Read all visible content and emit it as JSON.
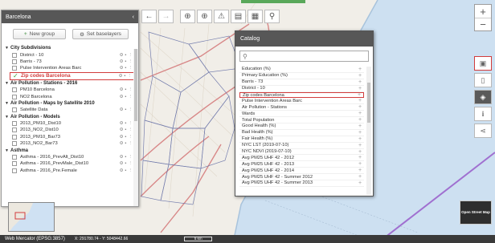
{
  "layer_panel": {
    "title": "Barcelona",
    "collapse_icon": "chevron-left-icon",
    "new_group_label": "New group",
    "set_baselayers_label": "Set baselayers",
    "groups": [
      {
        "name": "City Subdivisions",
        "layers": [
          {
            "name": "District - 10",
            "active": false
          },
          {
            "name": "Barris - 73",
            "active": false
          },
          {
            "name": "Pulse Intervention Areas Barc",
            "active": false
          },
          {
            "name": "Zip codes Barcelona",
            "active": true
          }
        ]
      },
      {
        "name": "Air Pollution - Stations - 2016",
        "layers": [
          {
            "name": "PM10 Barcelona",
            "active": false
          },
          {
            "name": "NO2 Barcelona",
            "active": false
          }
        ]
      },
      {
        "name": "Air Pollution - Maps by Satellite 2010",
        "layers": [
          {
            "name": "Satellite Data",
            "active": false
          }
        ]
      },
      {
        "name": "Air Pollution - Models",
        "layers": [
          {
            "name": "2013_PM10_Dist10",
            "active": false
          },
          {
            "name": "2013_NO2_Dist10",
            "active": false
          },
          {
            "name": "2013_PM10_Bar73",
            "active": false
          },
          {
            "name": "2013_NO2_Bar73",
            "active": false
          }
        ]
      },
      {
        "name": "Asthma",
        "layers": [
          {
            "name": "Asthma - 2016_PrevAlt_Dist10",
            "active": false
          },
          {
            "name": "Asthma - 2016_PrevMale_Dist10",
            "active": false
          },
          {
            "name": "Asthma - 2016_Pre.Female",
            "active": false
          }
        ]
      }
    ]
  },
  "toolbar": {
    "buttons": [
      "arrow-left-icon",
      "arrow-right-icon",
      "globe-icon",
      "plus-circle-icon",
      "warning-icon",
      "layers-icon",
      "bookmark-icon",
      "search-icon"
    ]
  },
  "catalog": {
    "title": "Catalog",
    "search_placeholder": "",
    "items": [
      "Education (%)",
      "Primary Education (%)",
      "Barris - 73",
      "District - 10",
      "Zip codes Barcelona",
      "Pulse Intervention Areas Barc",
      "Air Pollution - Stations",
      "Wards",
      "Total Population",
      "Good Health (%)",
      "Bad Health (%)",
      "Fair Health (%)",
      "NYC LST (2019-07-10)",
      "NYC NDVI (2019-07-10)",
      "Avg PM25 UHF 42 - 2012",
      "Avg PM25 UHF 42 - 2013",
      "Avg PM25 UHF 42 - 2014",
      "Avg PM25 UHF 42 - Summer 2012",
      "Avg PM25 UHF 42 - Summer 2013"
    ],
    "highlighted_item": "Zip codes Barcelona"
  },
  "map_controls": {
    "zoom_in": "+",
    "zoom_out": "−",
    "right_tools": [
      "save-icon",
      "document-icon",
      "layers-icon",
      "info-icon",
      "share-icon"
    ]
  },
  "basemap": {
    "label": "Open Street Map"
  },
  "statusbar": {
    "projection": "Web Mercator (EPSG:3857)",
    "coordinates": "X: 291780.74 - Y: 5048442.66",
    "scale": "5 km"
  },
  "colors": {
    "panel_header": "#575757",
    "highlight_red": "#d23c3c",
    "sea": "#cde0f1",
    "land": "#f1eee8",
    "road": "#d88888"
  }
}
